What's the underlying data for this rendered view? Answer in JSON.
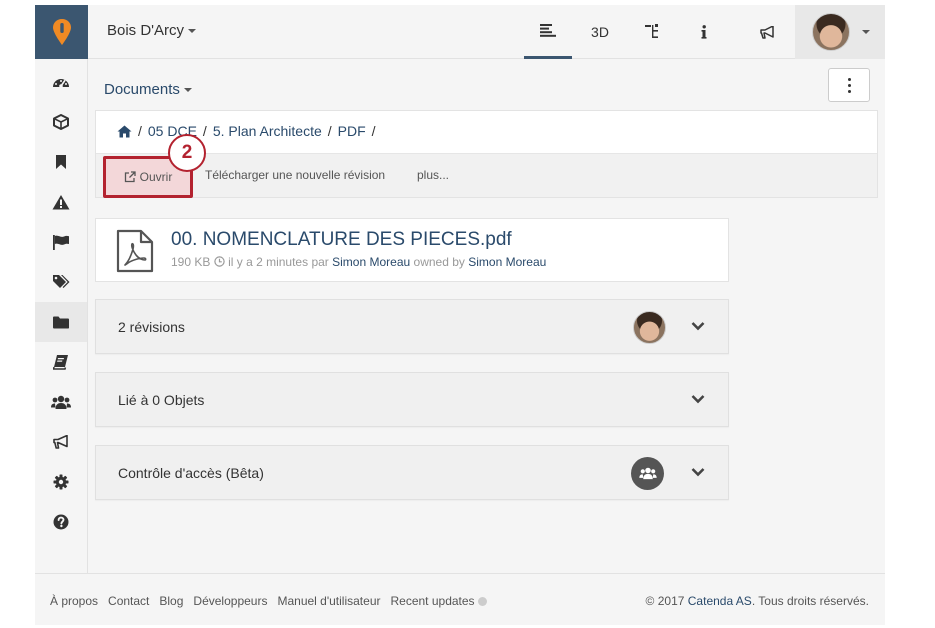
{
  "topbar": {
    "project_name": "Bois D'Arcy",
    "nav": [
      {
        "label": "",
        "icon": "list-view-icon",
        "active": true
      },
      {
        "label": "3D",
        "icon": "",
        "active": false
      },
      {
        "label": "",
        "icon": "tree-icon",
        "active": false
      },
      {
        "label": "",
        "icon": "info-icon",
        "active": false
      },
      {
        "label": "",
        "icon": "megaphone-icon",
        "active": false
      }
    ]
  },
  "sidebar": {
    "items": [
      {
        "icon": "dashboard-icon"
      },
      {
        "icon": "cube-icon"
      },
      {
        "icon": "bookmark-icon"
      },
      {
        "icon": "warning-icon"
      },
      {
        "icon": "flag-icon"
      },
      {
        "icon": "tags-icon"
      },
      {
        "icon": "folder-icon",
        "active": true
      },
      {
        "icon": "book-icon"
      },
      {
        "icon": "users-icon"
      },
      {
        "icon": "megaphone-icon"
      },
      {
        "icon": "gear-icon"
      },
      {
        "icon": "help-icon"
      }
    ]
  },
  "main": {
    "section_title": "Documents",
    "breadcrumb": [
      "05 DCE",
      "5. Plan Architecte",
      "PDF"
    ],
    "actions": {
      "open_label": "Ouvrir",
      "upload_label": "Télécharger une nouvelle révision",
      "more_label": "plus..."
    },
    "step_badge": "2",
    "file": {
      "name": "00. NOMENCLATURE DES PIECES.pdf",
      "size": "190 KB",
      "time": "il y a 2 minutes",
      "by_label": "par",
      "author": "Simon Moreau",
      "owned_label": "owned by",
      "owner": "Simon Moreau"
    },
    "panels": [
      {
        "title": "2 révisions"
      },
      {
        "title": "Lié à 0 Objets"
      },
      {
        "title": "Contrôle d'accès (Bêta)"
      }
    ]
  },
  "footer": {
    "links": [
      "À propos",
      "Contact",
      "Blog",
      "Développeurs",
      "Manuel d'utilisateur",
      "Recent updates"
    ],
    "copyright_prefix": "© 2017",
    "company": "Catenda AS",
    "copyright_suffix": ". Tous droits réservés."
  },
  "colors": {
    "brand_dark": "#3b5670",
    "link": "#2a4a6b",
    "highlight": "#b3222f",
    "logo_pin": "#f08a24"
  }
}
